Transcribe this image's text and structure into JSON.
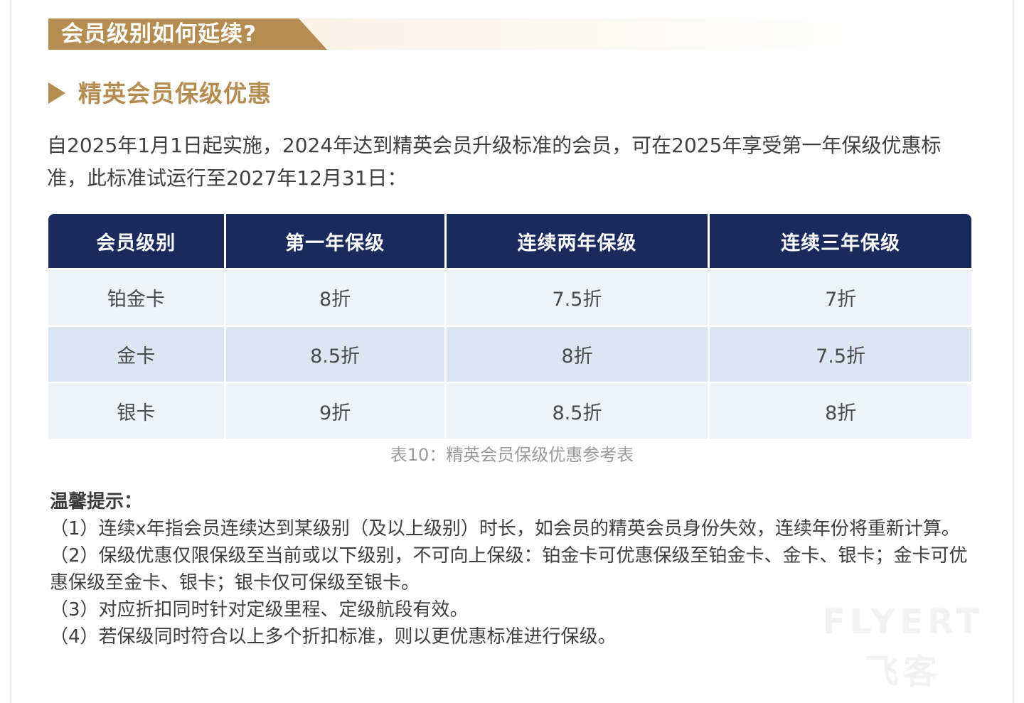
{
  "banner": {
    "title": "会员级别如何延续?"
  },
  "section": {
    "title": "精英会员保级优惠"
  },
  "intro": "自2025年1月1日起实施，2024年达到精英会员升级标准的会员，可在2025年享受第一年保级优惠标准，此标准试运行至2027年12月31日：",
  "table": {
    "headers": [
      "会员级别",
      "第一年保级",
      "连续两年保级",
      "连续三年保级"
    ],
    "rows": [
      [
        "铂金卡",
        "8折",
        "7.5折",
        "7折"
      ],
      [
        "金卡",
        "8.5折",
        "8折",
        "7.5折"
      ],
      [
        "银卡",
        "9折",
        "8.5折",
        "8折"
      ]
    ],
    "caption": "表10：精英会员保级优惠参考表"
  },
  "tips": {
    "title": "温馨提示：",
    "items": [
      "（1）连续x年指会员连续达到某级别（及以上级别）时长，如会员的精英会员身份失效，连续年份将重新计算。",
      "（2）保级优惠仅限保级至当前或以下级别，不可向上保级：铂金卡可优惠保级至铂金卡、金卡、银卡；金卡可优惠保级至金卡、银卡；银卡仅可保级至银卡。",
      "（3）对应折扣同时针对定级里程、定级航段有效。",
      "（4）若保级同时符合以上多个折扣标准，则以更优惠标准进行保级。"
    ]
  },
  "watermark": {
    "line1": "FLYERT",
    "line2": "飞客"
  },
  "colors": {
    "gold": "#b48d53",
    "navy": "#1b2a5c",
    "row_light": "#eef3fa",
    "row_dark": "#dce5f2"
  }
}
